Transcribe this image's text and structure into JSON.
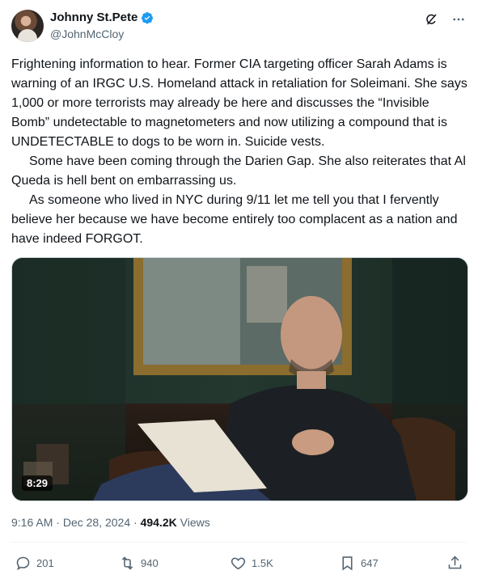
{
  "author": {
    "display_name": "Johnny St.Pete",
    "handle": "@JohnMcCloy",
    "verified": true
  },
  "tweet": {
    "paragraphs": [
      "Frightening information to hear. Former CIA targeting officer Sarah Adams is warning of an IRGC U.S. Homeland attack in retaliation for Soleimani. She says 1,000 or more terrorists may already be here and discusses the “Invisible Bomb” undetectable to magnetometers and now utilizing a compound that is UNDETECTABLE to dogs to be worn in. Suicide vests.",
      "Some have been coming through the Darien Gap. She also reiterates that Al Queda is hell bent on embarrassing us.",
      "As someone who lived in NYC during 9/11 let me tell you that I fervently believe her because we have become entirely too complacent as a nation and have indeed FORGOT."
    ]
  },
  "media": {
    "duration": "8:29"
  },
  "meta": {
    "time": "9:16 AM",
    "separator": "·",
    "date": "Dec 28, 2024",
    "views_count": "494.2K",
    "views_label": "Views"
  },
  "actions": {
    "replies": "201",
    "reposts": "940",
    "likes": "1.5K",
    "bookmarks": "647"
  },
  "colors": {
    "verified": "#1d9bf0",
    "secondary_text": "#536471",
    "primary_text": "#0f1419"
  },
  "icons": [
    "verified-badge-icon",
    "grok-icon",
    "more-icon",
    "reply-icon",
    "repost-icon",
    "like-icon",
    "bookmark-icon",
    "share-icon"
  ]
}
